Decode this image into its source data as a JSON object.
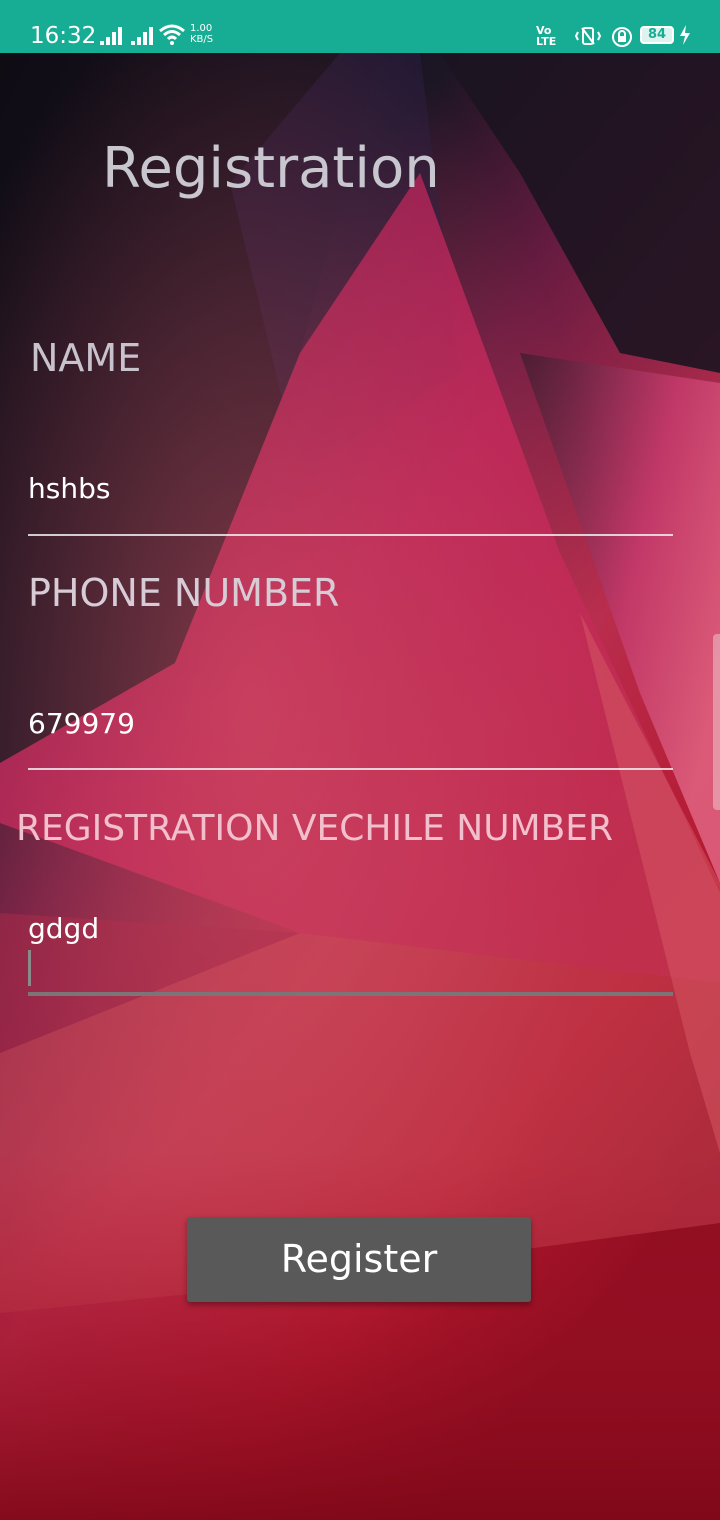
{
  "status_bar": {
    "time": "16:32",
    "net_speed_value": "1.00",
    "net_speed_unit": "KB/S",
    "volte_line1": "Vo",
    "volte_line2": "LTE",
    "battery": "84",
    "background_color": "#17ad94"
  },
  "screen": {
    "title": "Registration"
  },
  "form": {
    "name_label": "NAME",
    "name_value": "hshbs",
    "phone_label": "PHONE NUMBER",
    "phone_value": "679979",
    "vehicle_label": "REGISTRATION VECHILE NUMBER",
    "vehicle_value": "gdgd"
  },
  "actions": {
    "register_label": "Register"
  },
  "colors": {
    "button": "#59595a",
    "accent_pink": "#c2234a"
  }
}
